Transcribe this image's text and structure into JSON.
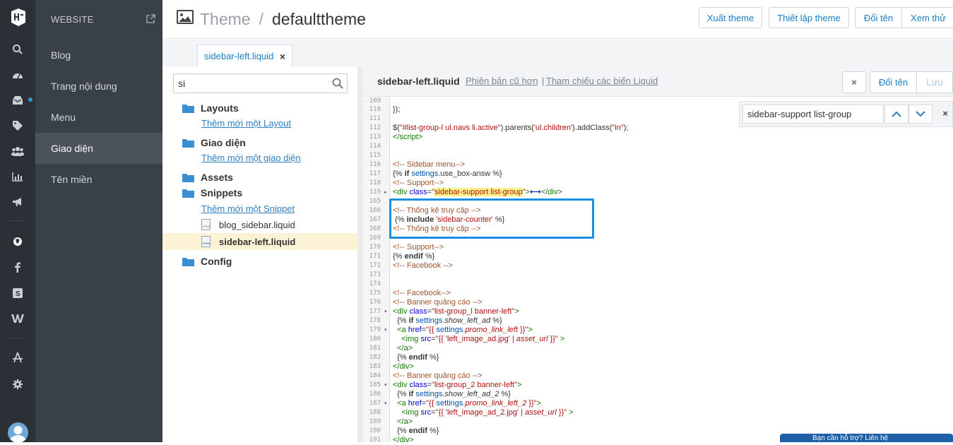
{
  "nav": {
    "header": "WEBSITE",
    "items": [
      {
        "label": "Blog"
      },
      {
        "label": "Trang nội dung"
      },
      {
        "label": "Menu"
      },
      {
        "label": "Giao diện"
      },
      {
        "label": "Tên miền"
      }
    ]
  },
  "topbar": {
    "crumb_root": "Theme",
    "crumb_sep": "/",
    "crumb_current": "defaulttheme",
    "buttons": {
      "export": "Xuất theme",
      "settings": "Thiết lập theme",
      "rename": "Đổi tên",
      "preview": "Xem thử"
    }
  },
  "tabs": [
    {
      "label": "sidebar-left.liquid",
      "close": "×"
    }
  ],
  "tree": {
    "search_value": "si",
    "folders": {
      "layouts": "Layouts",
      "layouts_add": "Thêm mới một Layout",
      "templates": "Giao diện",
      "templates_add": "Thêm mới một giao diện",
      "assets": "Assets",
      "snippets": "Snippets",
      "snippets_add": "Thêm mới một Snippet",
      "config": "Config"
    },
    "files": {
      "blog_sidebar": "blog_sidebar.liquid",
      "sidebar_left": "sidebar-left.liquid"
    }
  },
  "editor": {
    "filename": "sidebar-left.liquid",
    "link_old_versions": "Phiên bản cũ hơn",
    "link_sep": "|",
    "link_reference": "Tham chiếu các biến Liquid",
    "btn_close": "×",
    "btn_rename": "Đổi tên",
    "btn_save": "Lưu",
    "find_value": "sidebar-support list-group",
    "find_close": "×",
    "line_numbers": [
      "109",
      "110",
      "111",
      "112",
      "113",
      "114",
      "115",
      "116",
      "117",
      "118",
      "119",
      "165",
      "166",
      "167",
      "168",
      "169",
      "170",
      "171",
      "172",
      "173",
      "174",
      "175",
      "176",
      "177",
      "178",
      "179",
      "180",
      "181",
      "182",
      "183",
      "184",
      "185",
      "186",
      "187",
      "188",
      "189",
      "190",
      "191"
    ]
  },
  "chat": {
    "label": "Bạn cần hỗ trợ? Liên hệ"
  },
  "colors": {
    "accent": "#1b8fe3",
    "link": "#2f7fc1",
    "rail": "#2b3036",
    "nav": "#3a4047",
    "selected": "#fcf3d6"
  }
}
